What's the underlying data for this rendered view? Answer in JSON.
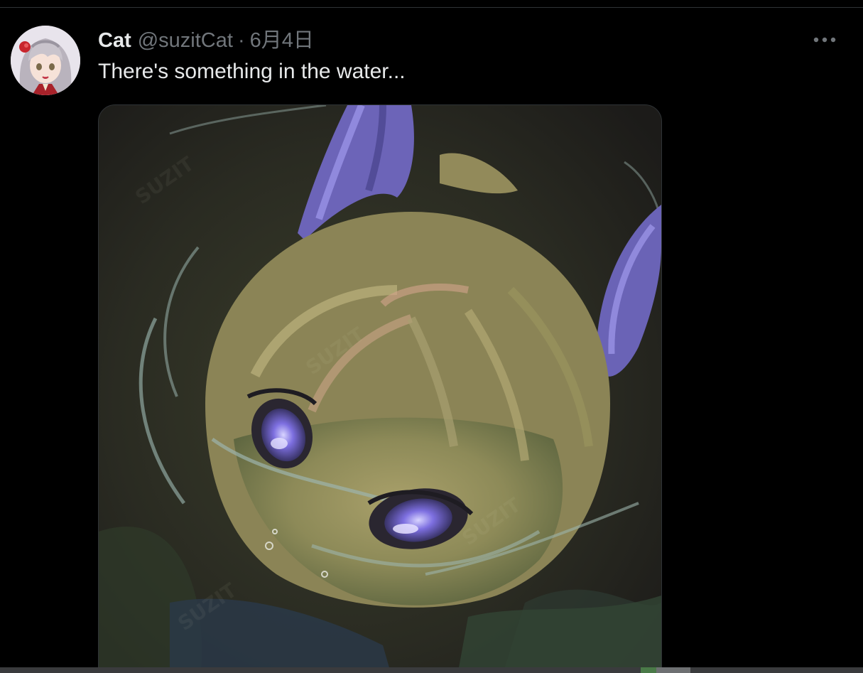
{
  "tweet": {
    "author": {
      "display_name": "Cat",
      "handle": "@suzitCat",
      "avatar_icon": "avatar-illustration"
    },
    "separator": "·",
    "date": "6月4日",
    "text": "There's something in the water...",
    "more_icon": "more-horizontal-icon",
    "media": {
      "icon": "illustration-image",
      "watermark": "SUZIT"
    }
  },
  "colors": {
    "background": "#000000",
    "primary_text": "#e7e9ea",
    "secondary_text": "#71767b",
    "divider": "#2f3336"
  }
}
